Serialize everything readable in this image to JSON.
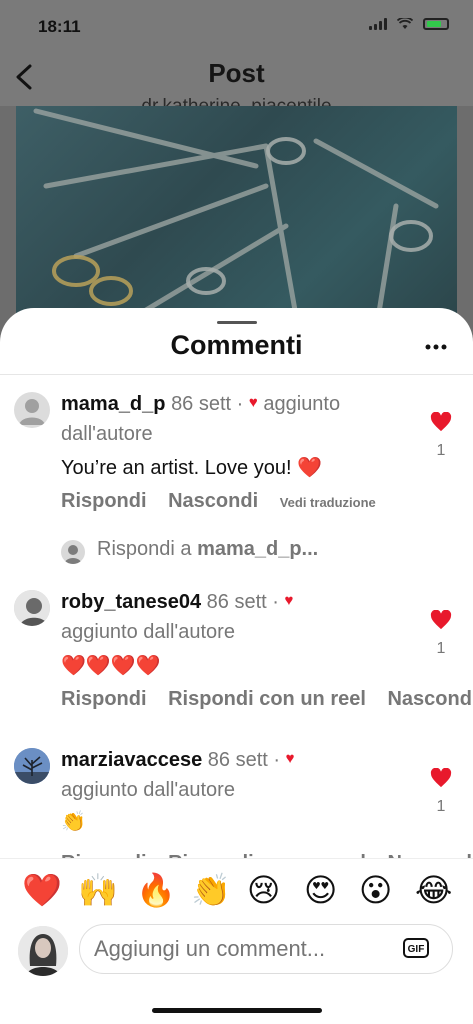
{
  "status": {
    "time": "18:11"
  },
  "header": {
    "title": "Post",
    "username": "dr.katherine_piacentile"
  },
  "sheet": {
    "title": "Commenti"
  },
  "comments": [
    {
      "user": "mama_d_p",
      "age": "86 sett",
      "author_tag": "aggiunto dall'autore",
      "text": "You’re an artist. Love you! ❤️",
      "likes": "1",
      "actions": {
        "reply": "Rispondi",
        "hide": "Nascondi",
        "translate": "Vedi traduzione"
      }
    },
    {
      "user": "roby_tanese04",
      "age": "86 sett",
      "author_tag": "aggiunto dall'autore",
      "text": "❤️❤️❤️❤️",
      "likes": "1",
      "actions": {
        "reply": "Rispondi",
        "reel": "Rispondi con un reel",
        "hide": "Nascondi"
      }
    },
    {
      "user": "marziavaccese",
      "age": "86 sett",
      "author_tag": "aggiunto dall'autore",
      "text": "👏",
      "likes": "1",
      "actions": {
        "reply": "Rispondi",
        "reel": "Rispondi con un reel",
        "hide": "Nascondi"
      }
    }
  ],
  "reply_prompt": {
    "prefix": "Rispondi a ",
    "user": "mama_d_p..."
  },
  "emoji_bar": [
    "❤️",
    "🙌",
    "🔥",
    "👏",
    "😢",
    "😍",
    "😮",
    "😂"
  ],
  "composer": {
    "placeholder": "Aggiungi un comment...",
    "gif_label": "GIF"
  },
  "colors": {
    "like_red": "#e8192c",
    "muted_text": "#777777"
  }
}
